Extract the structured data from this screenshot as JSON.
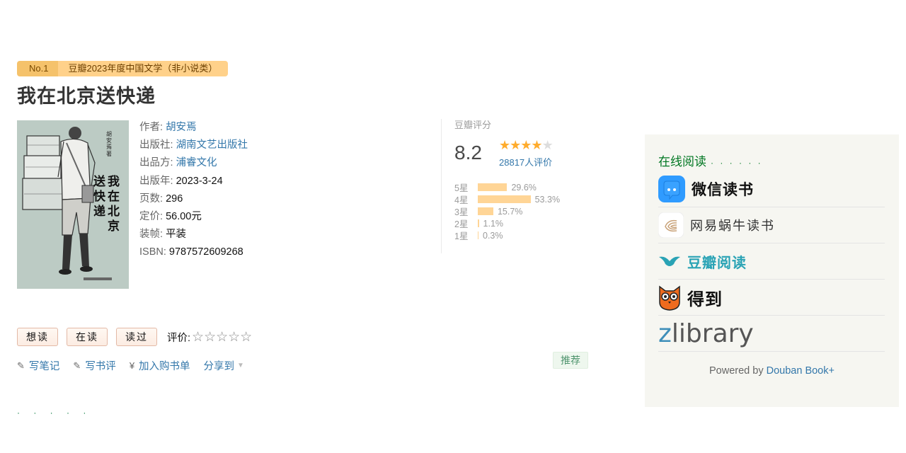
{
  "award": {
    "rank": "No.1",
    "text": "豆瓣2023年度中国文学（非小说类）"
  },
  "book": {
    "title": "我在北京送快递",
    "cover_title": "我在北京送快递",
    "cover_author": "胡安焉 著"
  },
  "info": [
    {
      "label": "作者:",
      "value": "胡安焉",
      "link": true
    },
    {
      "label": "出版社:",
      "value": "湖南文艺出版社",
      "link": true
    },
    {
      "label": "出品方:",
      "value": "浦睿文化",
      "link": true
    },
    {
      "label": "出版年:",
      "value": "2023-3-24",
      "link": false
    },
    {
      "label": "页数:",
      "value": "296",
      "link": false
    },
    {
      "label": "定价:",
      "value": "56.00元",
      "link": false
    },
    {
      "label": "装帧:",
      "value": "平装",
      "link": false
    },
    {
      "label": "ISBN:",
      "value": "9787572609268",
      "link": false
    }
  ],
  "rating": {
    "header": "豆瓣评分",
    "score": "8.2",
    "stars_filled": 4,
    "stars_total": 5,
    "count_text": "28817人评价",
    "distribution": [
      {
        "label": "5星",
        "percent": 29.6,
        "text": "29.6%"
      },
      {
        "label": "4星",
        "percent": 53.3,
        "text": "53.3%"
      },
      {
        "label": "3星",
        "percent": 15.7,
        "text": "15.7%"
      },
      {
        "label": "2星",
        "percent": 1.1,
        "text": "1.1%"
      },
      {
        "label": "1星",
        "percent": 0.3,
        "text": "0.3%"
      }
    ]
  },
  "buttons": {
    "want": "想读",
    "reading": "在读",
    "read": "读过",
    "rate_label": "评价:"
  },
  "actions": {
    "note": "写笔记",
    "review": "写书评",
    "cart": "加入购书单",
    "share": "分享到",
    "recommend": "推荐"
  },
  "online": {
    "title": "在线阅读",
    "vendors": [
      {
        "name": "微信读书",
        "icon": "wechat-read-icon"
      },
      {
        "name": "网易蜗牛读书",
        "icon": "netease-snail-icon"
      },
      {
        "name": "豆瓣阅读",
        "icon": "douban-read-bird-icon"
      },
      {
        "name": "得到",
        "icon": "dedao-owl-icon"
      },
      {
        "name": "zlibrary",
        "icon": "zlibrary-logo"
      }
    ],
    "powered_prefix": "Powered by",
    "powered_link": "Douban Book+"
  },
  "colors": {
    "link": "#3377aa",
    "star": "#ffac2d",
    "bar": "#ffd596",
    "online_title": "#007722"
  }
}
